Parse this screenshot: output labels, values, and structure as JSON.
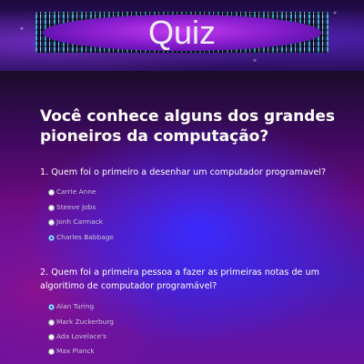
{
  "header": {
    "title": "Quiz"
  },
  "main": {
    "heading": "Você conhece alguns dos grandes pioneiros da computação?",
    "questions": [
      {
        "text": "1. Quem foi o primeiro a desenhar um computador programavel?",
        "options": [
          {
            "label": "Carrie Anne",
            "checked": false
          },
          {
            "label": "Steeve Jobs",
            "checked": false
          },
          {
            "label": "Jonh Carmack",
            "checked": false
          },
          {
            "label": "Charles Babbage",
            "checked": true
          }
        ]
      },
      {
        "text": "2. Quem foi a primeira pessoa a fazer as primeiras notas de um algoritimo de computador programável?",
        "options": [
          {
            "label": "Alan Turing",
            "checked": true
          },
          {
            "label": "Mark Zuckerburg",
            "checked": false
          },
          {
            "label": "Ada Lovelace's",
            "checked": false
          },
          {
            "label": "Max Planck",
            "checked": false
          }
        ]
      }
    ]
  },
  "colors": {
    "selected_radio": "#1f5fd6",
    "option_text": "#c9c4d8"
  }
}
